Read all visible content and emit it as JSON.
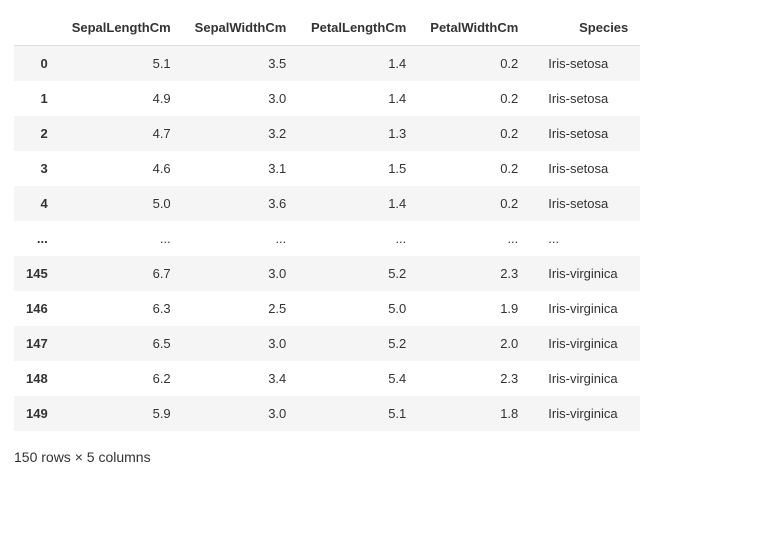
{
  "chart_data": {
    "type": "table",
    "columns": [
      "SepalLengthCm",
      "SepalWidthCm",
      "PetalLengthCm",
      "PetalWidthCm",
      "Species"
    ],
    "index": [
      "0",
      "1",
      "2",
      "3",
      "4",
      "...",
      "145",
      "146",
      "147",
      "148",
      "149"
    ],
    "rows": [
      [
        "5.1",
        "3.5",
        "1.4",
        "0.2",
        "Iris-setosa"
      ],
      [
        "4.9",
        "3.0",
        "1.4",
        "0.2",
        "Iris-setosa"
      ],
      [
        "4.7",
        "3.2",
        "1.3",
        "0.2",
        "Iris-setosa"
      ],
      [
        "4.6",
        "3.1",
        "1.5",
        "0.2",
        "Iris-setosa"
      ],
      [
        "5.0",
        "3.6",
        "1.4",
        "0.2",
        "Iris-setosa"
      ],
      [
        "...",
        "...",
        "...",
        "...",
        "..."
      ],
      [
        "6.7",
        "3.0",
        "5.2",
        "2.3",
        "Iris-virginica"
      ],
      [
        "6.3",
        "2.5",
        "5.0",
        "1.9",
        "Iris-virginica"
      ],
      [
        "6.5",
        "3.0",
        "5.2",
        "2.0",
        "Iris-virginica"
      ],
      [
        "6.2",
        "3.4",
        "5.4",
        "2.3",
        "Iris-virginica"
      ],
      [
        "5.9",
        "3.0",
        "5.1",
        "1.8",
        "Iris-virginica"
      ]
    ],
    "total_rows": 150,
    "total_cols": 5
  },
  "summary": "150 rows × 5 columns"
}
